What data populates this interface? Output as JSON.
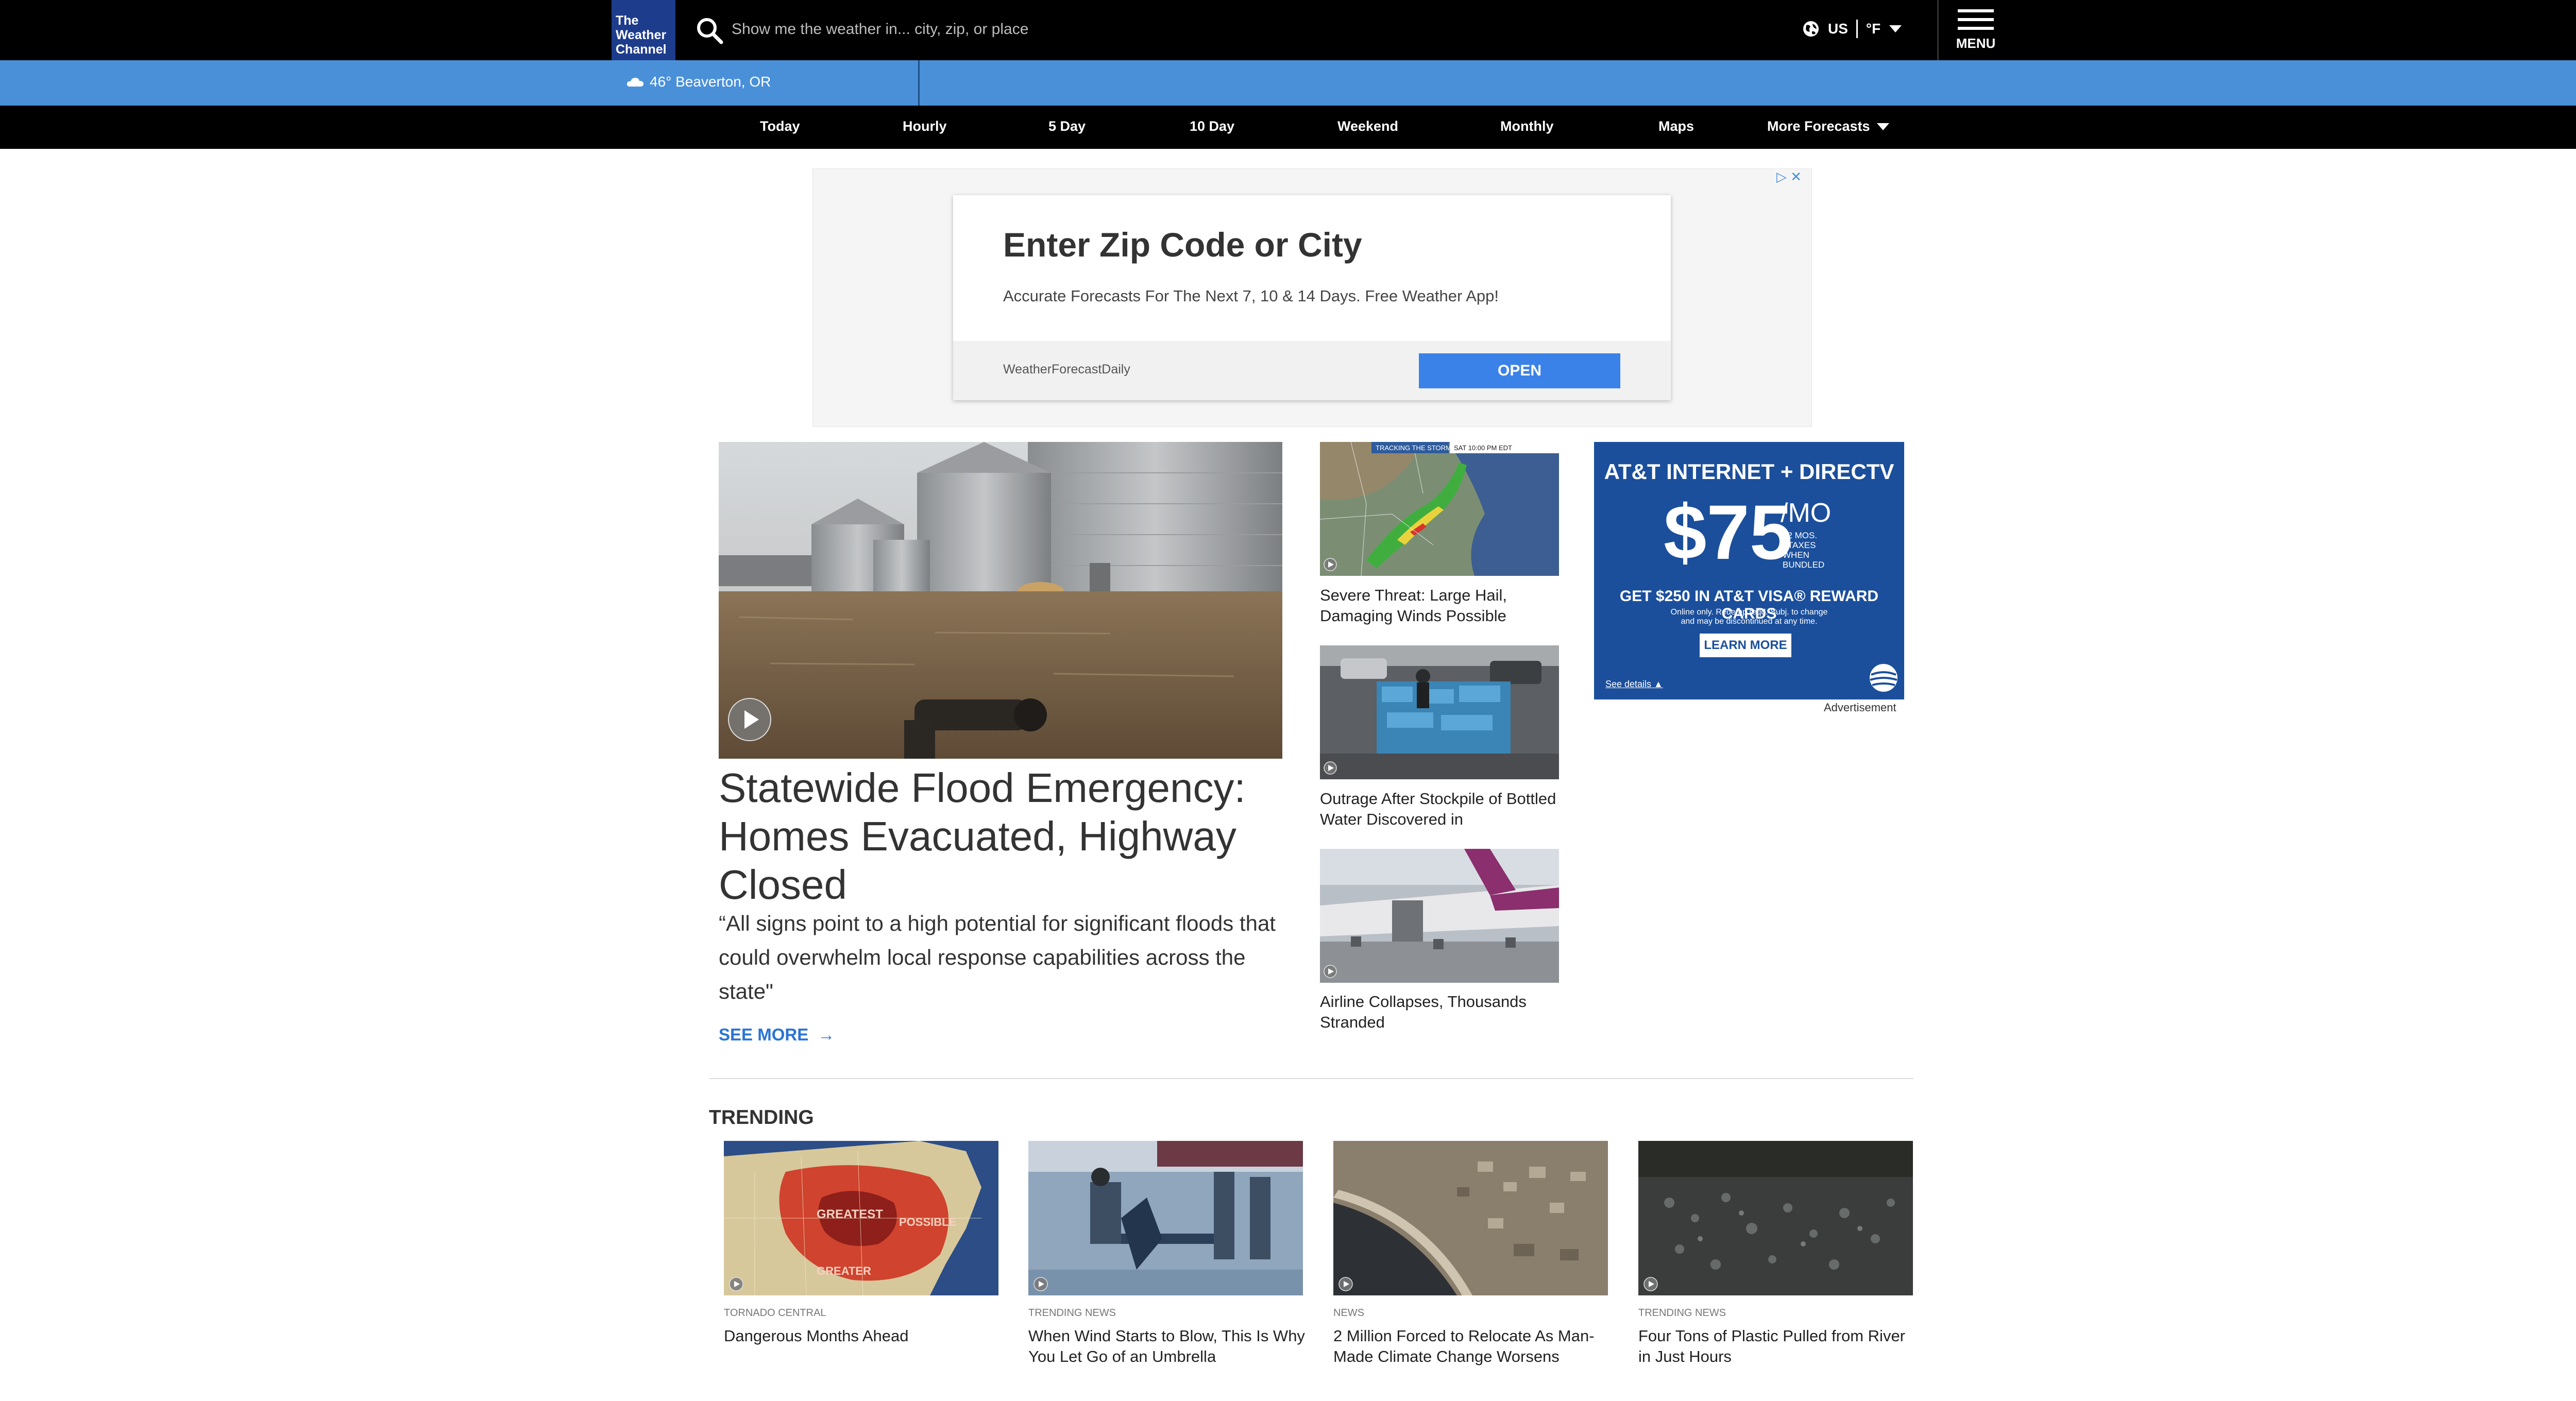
{
  "header": {
    "logo_text": "The Weather Channel",
    "search_placeholder": "Show me the weather in... city, zip, or place",
    "country": "US",
    "unit": "°F",
    "menu_label": "MENU"
  },
  "location_bar": {
    "current": "46° Beaverton, OR"
  },
  "nav": {
    "items": [
      "Today",
      "Hourly",
      "5 Day",
      "10 Day",
      "Weekend",
      "Monthly",
      "Maps",
      "More Forecasts"
    ]
  },
  "ad": {
    "title": "Enter Zip Code or City",
    "description": "Accurate Forecasts For The Next 7, 10 & 14 Days. Free Weather App!",
    "sponsor": "WeatherForecastDaily",
    "button": "OPEN"
  },
  "hero": {
    "title": "Statewide Flood Emergency: Homes Evacuated, Highway Closed",
    "description": "“All signs point to a high potential for significant floods that could overwhelm local response capabilities across the state\"",
    "see_more": "SEE MORE"
  },
  "side_stories": [
    {
      "title": "Severe Threat: Large Hail, Damaging Winds Possible",
      "overlay_left": "TRACKING THE STORM",
      "overlay_right": "SAT 10:00 PM EDT"
    },
    {
      "title": "Outrage After Stockpile of Bottled Water Discovered in"
    },
    {
      "title": "Airline Collapses, Thousands Stranded"
    }
  ],
  "right_ad": {
    "heading": "AT&T INTERNET + DIRECTV",
    "price": "$75",
    "per": "/MO",
    "terms": "12 MOS. +TAXES WHEN BUNDLED",
    "offer": "GET $250 IN AT&T VISA® REWARD CARDS",
    "fine_print": "Online only. Redemp reqd. Subj. to change and may be discontinued at any time.",
    "cta": "LEARN MORE",
    "see_details": "See details ▲",
    "label": "Advertisement"
  },
  "trending": {
    "heading": "TRENDING",
    "items": [
      {
        "category": "TORNADO CENTRAL",
        "title": "Dangerous Months Ahead",
        "map_labels": [
          "GREATEST",
          "POSSIBLE",
          "GREATER"
        ]
      },
      {
        "category": "TRENDING NEWS",
        "title": "When Wind Starts to Blow, This Is Why You Let Go of an Umbrella"
      },
      {
        "category": "NEWS",
        "title": "2 Million Forced to Relocate As Man-Made Climate Change Worsens"
      },
      {
        "category": "TRENDING NEWS",
        "title": "Four Tons of Plastic Pulled from River in Just Hours"
      }
    ]
  },
  "colors": {
    "header_bg": "#000000",
    "location_bar": "#4a90d9",
    "logo_bg": "#1e3c8c",
    "link_blue": "#2a73d6",
    "ad_button": "#3b82e8",
    "att_blue": "#1b4f9c"
  }
}
